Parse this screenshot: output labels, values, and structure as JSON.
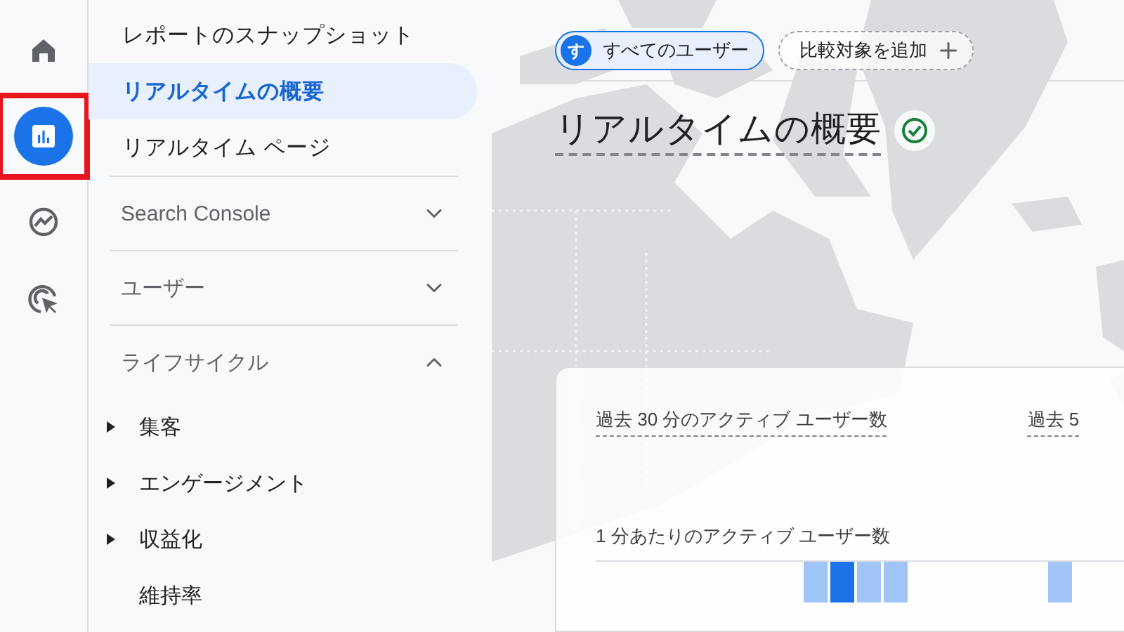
{
  "rail": [
    {
      "kind": "home",
      "selected": false,
      "annotated": false
    },
    {
      "kind": "reports",
      "selected": true,
      "annotated": true
    },
    {
      "kind": "explore",
      "selected": false,
      "annotated": false
    },
    {
      "kind": "advertising",
      "selected": false,
      "annotated": false
    }
  ],
  "nav": [
    {
      "kind": "link",
      "label": "レポートのスナップショット",
      "selected": false
    },
    {
      "kind": "link",
      "label": "リアルタイムの概要",
      "selected": true
    },
    {
      "kind": "link",
      "label": "リアルタイム ページ",
      "selected": false
    },
    {
      "kind": "section",
      "label": "Search Console",
      "expanded": false
    },
    {
      "kind": "section",
      "label": "ユーザー",
      "expanded": false
    },
    {
      "kind": "section",
      "label": "ライフサイクル",
      "expanded": true,
      "children": [
        {
          "label": "集客",
          "expandable": true
        },
        {
          "label": "エンゲージメント",
          "expandable": true
        },
        {
          "label": "収益化",
          "expandable": true
        },
        {
          "label": "維持率",
          "expandable": false
        }
      ]
    }
  ],
  "main": {
    "segment": {
      "avatar": "す",
      "label": "すべてのユーザー",
      "selected": true
    },
    "add_comparison": {
      "label": "比較対象を追加"
    },
    "title": "リアルタイムの概要",
    "card": {
      "metrics": [
        "過去 30 分のアクティブ ユーザー数",
        "過去 5"
      ],
      "chart_label": "1 分あたりのアクティブ ユーザー数"
    }
  }
}
